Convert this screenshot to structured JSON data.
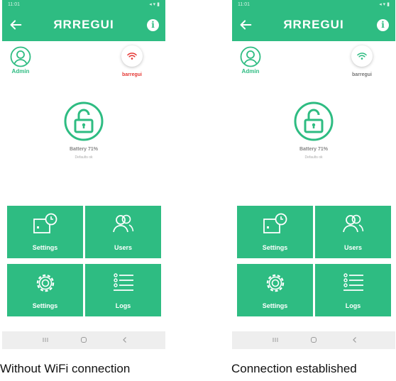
{
  "screens": [
    {
      "status_time": "11:01",
      "brand": "ЯRREGUI",
      "user_label": "Admin",
      "device_label": "barregui",
      "battery_text": "Battery 71%",
      "subtext": "Defaults ok",
      "tiles": [
        "Settings",
        "Users",
        "Settings",
        "Logs"
      ],
      "wifi_color": "#e53935",
      "caption": "Without WiFi connection"
    },
    {
      "status_time": "11:01",
      "brand": "ЯRREGUI",
      "user_label": "Admin",
      "device_label": "barregui",
      "battery_text": "Battery 71%",
      "subtext": "Defaults ok",
      "tiles": [
        "Settings",
        "Users",
        "Settings",
        "Logs"
      ],
      "wifi_color": "#2ebc82",
      "caption": "Connection established"
    }
  ],
  "colors": {
    "accent": "#2ebc82",
    "wifi_off": "#e53935",
    "wifi_on": "#2ebc82"
  },
  "icons": [
    "back-arrow-icon",
    "info-icon",
    "user-avatar-icon",
    "wifi-icon",
    "padlock-open-icon",
    "clock-schedule-icon",
    "users-icon",
    "gear-icon",
    "list-icon",
    "recents-icon",
    "home-icon",
    "back-icon"
  ]
}
